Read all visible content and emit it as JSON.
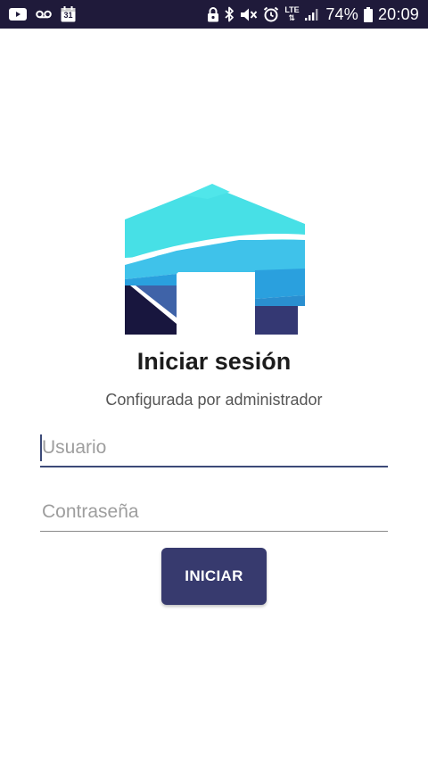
{
  "status_bar": {
    "calendar_day": "31",
    "network": "LTE",
    "battery": "74%",
    "time": "20:09",
    "background": "#1f1a3a"
  },
  "login": {
    "title": "Iniciar sesión",
    "subtitle": "Configurada por administrador",
    "username_placeholder": "Usuario",
    "username_value": "",
    "password_placeholder": "Contraseña",
    "password_value": "",
    "submit_label": "INICIAR",
    "accent_color": "#373a6e"
  },
  "icons": [
    "youtube-icon",
    "voicemail-icon",
    "calendar-icon",
    "lock-icon",
    "bluetooth-icon",
    "mute-icon",
    "alarm-icon",
    "signal-icon",
    "battery-icon",
    "app-logo-icon"
  ]
}
